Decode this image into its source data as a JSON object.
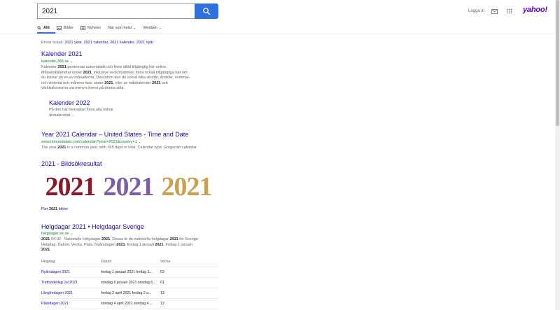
{
  "search": {
    "query": "2021"
  },
  "header": {
    "login": "Logga in",
    "logo": "yahoo!",
    "mail_icon": "mail-icon",
    "apps_icon": "apps-grid-icon"
  },
  "tabs": [
    {
      "label": "Allt",
      "icon": "search-icon",
      "active": true
    },
    {
      "label": "Bilder",
      "icon": "image-icon"
    },
    {
      "label": "Nyheter",
      "icon": "news-icon"
    },
    {
      "label": "När som helst",
      "dropdown": true
    },
    {
      "label": "Webben",
      "dropdown": true
    }
  ],
  "also_try": {
    "label": "Prova också:",
    "items": [
      "2021 year",
      "2021 calendar",
      "2021 kalender",
      "2021 nyår"
    ]
  },
  "result1": {
    "title": "Kalender 2021",
    "url": "kalender-365.se",
    "snippet_lines": [
      "Kalender 2021 genereras automatiskt och finns alltid tillgänglig här online.",
      "Månadskalendrar under 2021, inklusive veckonummer, finns också tillgängliga här om",
      "du klickar på en av månaderna. Dessutom kan du också hitta skottår, årstider, sommar-",
      "och vintertid och månens fase under 2021, eller se månkalender 2021 och",
      "världsklockorna via menyn överst på denna sida."
    ],
    "sublink": {
      "title": "Kalender 2022",
      "snippet_lines": [
        "På den här hemsidan finns alla online",
        "årskalendrar ..."
      ]
    }
  },
  "result2": {
    "title": "Year 2021 Calendar – United States - Time and Date",
    "url": "www.timeanddate.com/calendar/?year=2021&country=1",
    "snippet": "The year 2021 is a common year, with 365 days in total. Calendar type: Gregorian calendar"
  },
  "images": {
    "title": "2021 - Bildsökresultat",
    "tiles": [
      "2021",
      "2021",
      "2021"
    ],
    "more": "Fler 2021 bilder"
  },
  "result3": {
    "title": "Helgdagar 2021 • Helgdagar Sverige",
    "url": "helgdagar-se.se",
    "snippet_lines": [
      "2021-04-02 · Nationelle Helgdagar 2021. Dessa är de nationella helgdagar 2021 för Sverige:",
      "Helgdag. Datum. Vecka. Plats. Nyårsdagen 2021. fredag 1 januari 2021. fredag 1 januari",
      "2021."
    ]
  },
  "table": {
    "headers": [
      "Helgdag",
      "Datum",
      "Vecka"
    ],
    "rows": [
      [
        "Nyårsdagen 2021",
        "fredag 1 januari 2021 fredag 1...",
        "53"
      ],
      [
        "Trettondedag Jul 2021",
        "onsdag 6 januari 2021 onsdag 6...",
        "01"
      ],
      [
        "Långfredagen 2021",
        "fredag 2 april 2021 fredag 2 a...",
        "13"
      ],
      [
        "Påskdagen 2021",
        "söndag 4 april 2021 söndag 4 ...",
        "13"
      ]
    ]
  },
  "colors": {
    "link": "#1a0dab",
    "url": "#188038",
    "accent": "#2f6fde",
    "logo": "#6001d2"
  }
}
